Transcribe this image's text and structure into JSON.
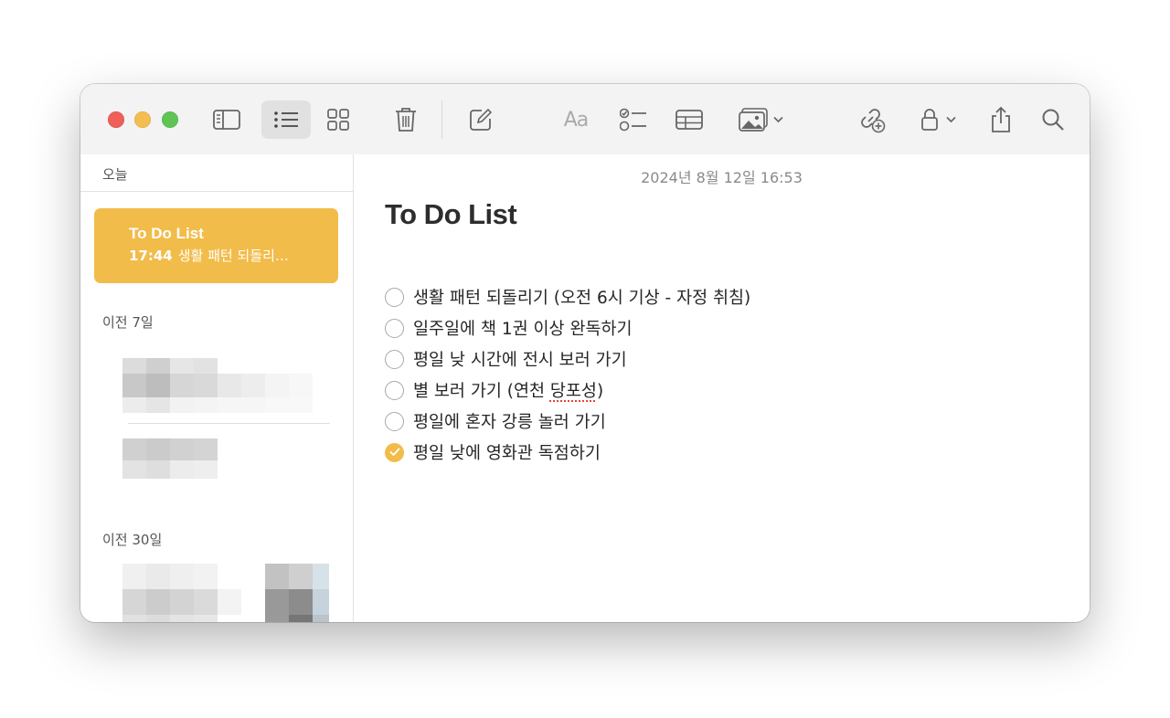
{
  "toolbar": {
    "buttons": [
      {
        "name": "sidebar-toggle",
        "icon": "sidebar-icon"
      },
      {
        "name": "list-view",
        "icon": "list-icon",
        "active": true
      },
      {
        "name": "gallery-view",
        "icon": "grid-icon"
      },
      {
        "name": "delete",
        "icon": "trash-icon"
      },
      {
        "name": "new-note",
        "icon": "compose-icon"
      },
      {
        "name": "format",
        "icon": "text-format-icon",
        "label": "Aa"
      },
      {
        "name": "checklist",
        "icon": "checklist-icon"
      },
      {
        "name": "table",
        "icon": "table-icon"
      },
      {
        "name": "media",
        "icon": "media-icon"
      },
      {
        "name": "collaborate",
        "icon": "link-add-icon"
      },
      {
        "name": "lock",
        "icon": "lock-icon"
      },
      {
        "name": "share",
        "icon": "share-icon"
      },
      {
        "name": "search",
        "icon": "search-icon"
      }
    ],
    "format_label": "Aa"
  },
  "sidebar": {
    "sections": {
      "today": "오늘",
      "prev7": "이전 7일",
      "prev30": "이전 30일"
    },
    "selected_note": {
      "title": "To Do List",
      "time": "17:44",
      "preview": "생활 패턴 되돌리…"
    }
  },
  "note": {
    "date": "2024년 8월 12일 16:53",
    "title": "To Do List",
    "checklist": [
      {
        "text": "생활 패턴 되돌리기 (오전 6시 기상 - 자정 취침)",
        "checked": false
      },
      {
        "text": "일주일에 책 1권 이상 완독하기",
        "checked": false
      },
      {
        "text": "평일 낮 시간에 전시 보러 가기",
        "checked": false
      },
      {
        "text_before": "별 보러 가기 (연천 ",
        "text_flagged": "당포성",
        "text_after": ")",
        "checked": false
      },
      {
        "text": "평일에 혼자 강릉 놀러 가기",
        "checked": false
      },
      {
        "text": "평일 낮에 영화관 독점하기",
        "checked": true
      }
    ]
  },
  "colors": {
    "accent": "#f2bc4a",
    "close": "#ee5f57",
    "minimize": "#f4bd4f",
    "zoom": "#5fc454"
  }
}
